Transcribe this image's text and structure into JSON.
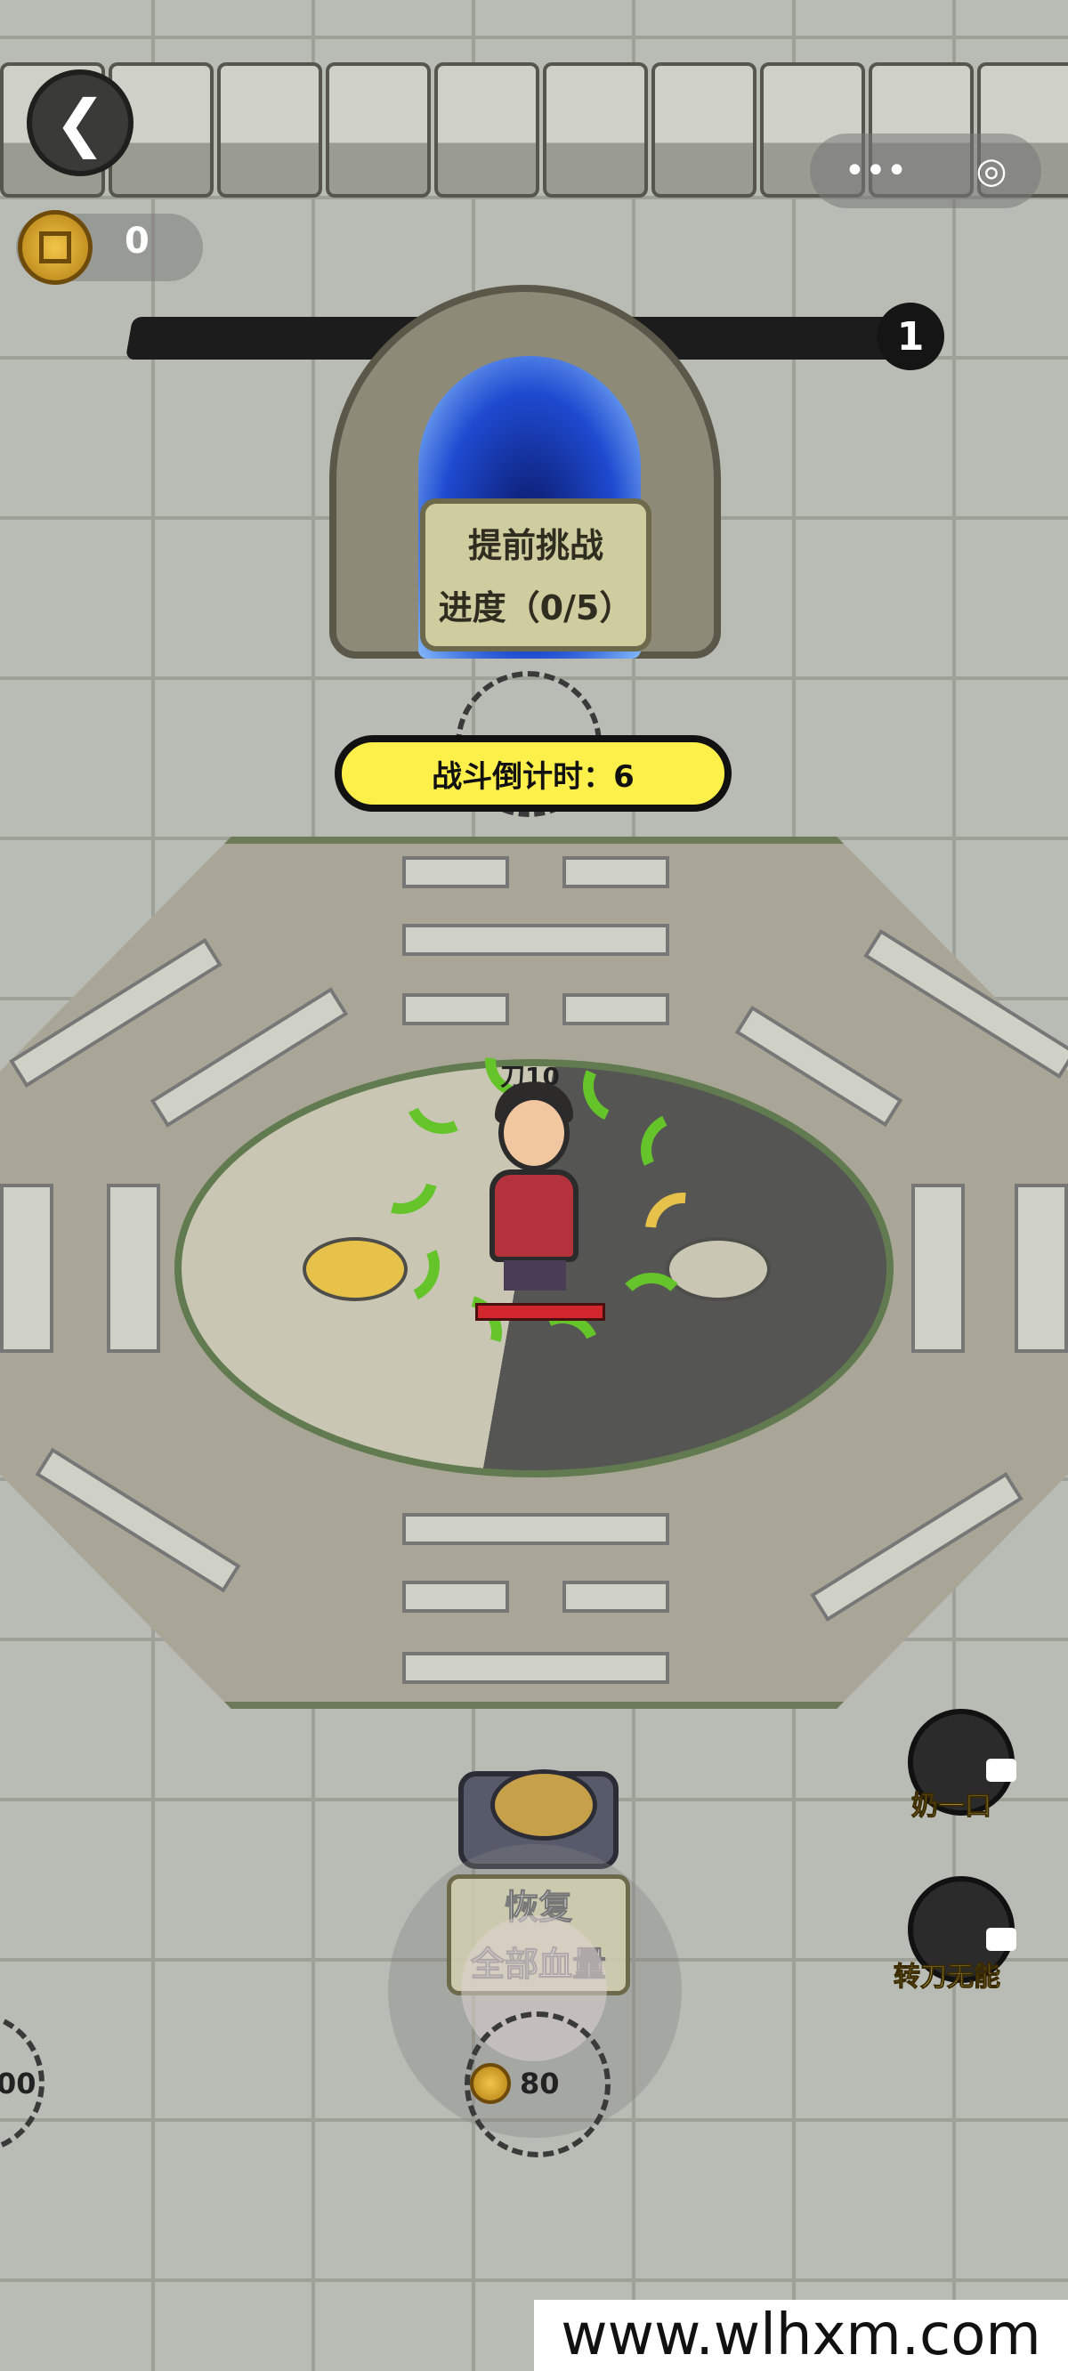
{
  "hud": {
    "coins": "0",
    "level": "1",
    "menu_dots": "•••",
    "target_glyph": "◎",
    "back_glyph": "❮"
  },
  "portal": {
    "line1": "提前挑战",
    "line2": "进度（0/5）"
  },
  "countdown_text": "战斗倒计时：6",
  "hero": {
    "label": "刀10",
    "hp_fraction": 1.0
  },
  "side_buttons": [
    {
      "label": "奶一口",
      "icon": "meat-icon"
    },
    {
      "label": "转刀无能",
      "icon": "crescent-blade-icon"
    }
  ],
  "station": {
    "line1": "恢复",
    "line2": "全部血量",
    "cost": "80"
  },
  "left_ring_value": "00",
  "watermark": "www.wlhxm.com",
  "colors": {
    "countdown_bg": "#fef04a",
    "blade_green": "#66c42b",
    "blade_yellow": "#e6c24a",
    "hp_red": "#d1262b"
  }
}
